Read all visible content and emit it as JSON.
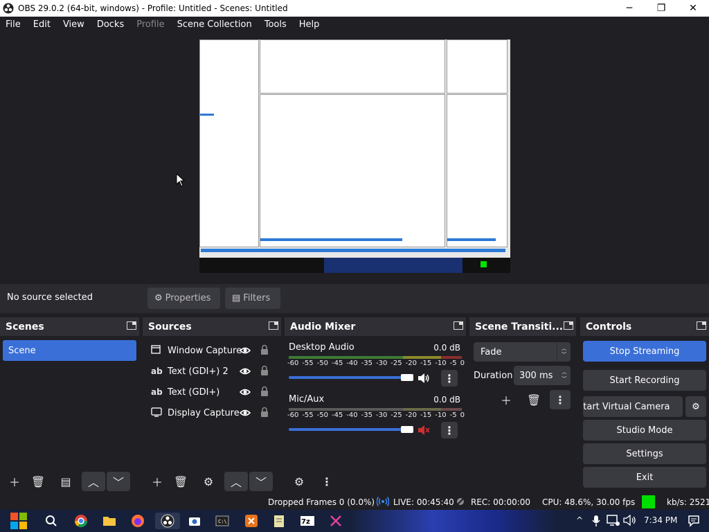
{
  "window": {
    "title": "OBS 29.0.2 (64-bit, windows) - Profile: Untitled - Scenes: Untitled",
    "controls": {
      "minimize": "─",
      "maximize": "❐",
      "close": "✕"
    }
  },
  "menu": [
    "File",
    "Edit",
    "View",
    "Docks",
    "Profile",
    "Scene Collection",
    "Tools",
    "Help"
  ],
  "source_toolbar": {
    "no_source": "No source selected",
    "properties": "Properties",
    "filters": "Filters"
  },
  "scenes": {
    "title": "Scenes",
    "items": [
      "Scene"
    ]
  },
  "sources": {
    "title": "Sources",
    "items": [
      {
        "name": "Window Capture",
        "icon": "window-icon"
      },
      {
        "name": "Text (GDI+) 2",
        "icon": "text-icon"
      },
      {
        "name": "Text (GDI+)",
        "icon": "text-icon"
      },
      {
        "name": "Display Capture",
        "icon": "monitor-icon"
      }
    ]
  },
  "audio_mixer": {
    "title": "Audio Mixer",
    "channels": [
      {
        "name": "Desktop Audio",
        "db": "0.0 dB",
        "volume": 1.0,
        "muted": false
      },
      {
        "name": "Mic/Aux",
        "db": "0.0 dB",
        "volume": 1.0,
        "muted": true
      }
    ],
    "scale": [
      "-60",
      "-55",
      "-50",
      "-45",
      "-40",
      "-35",
      "-30",
      "-25",
      "-20",
      "-15",
      "-10",
      "-5",
      "0"
    ]
  },
  "scene_transitions": {
    "title": "Scene Transiti...",
    "transition": "Fade",
    "duration_label": "Duration",
    "duration": "300 ms"
  },
  "controls": {
    "title": "Controls",
    "stop_streaming": "Stop Streaming",
    "start_recording": "Start Recording",
    "start_virtual_camera": "Start Virtual Camera",
    "studio_mode": "Studio Mode",
    "settings": "Settings",
    "exit": "Exit"
  },
  "status": {
    "dropped": "Dropped Frames 0 (0.0%)",
    "live": "LIVE: 00:45:40",
    "rec": "REC: 00:00:00",
    "cpu": "CPU: 48.6%, 30.00 fps",
    "kbs": "kb/s: 2521"
  },
  "taskbar": {
    "time": "7:34 PM",
    "tray_arrow": "^"
  },
  "colors": {
    "accent": "#3a6fd8",
    "background": "#1f1f24",
    "panel": "#2a2a2f",
    "status_green": "#00e000",
    "muted_red": "#d03030"
  }
}
